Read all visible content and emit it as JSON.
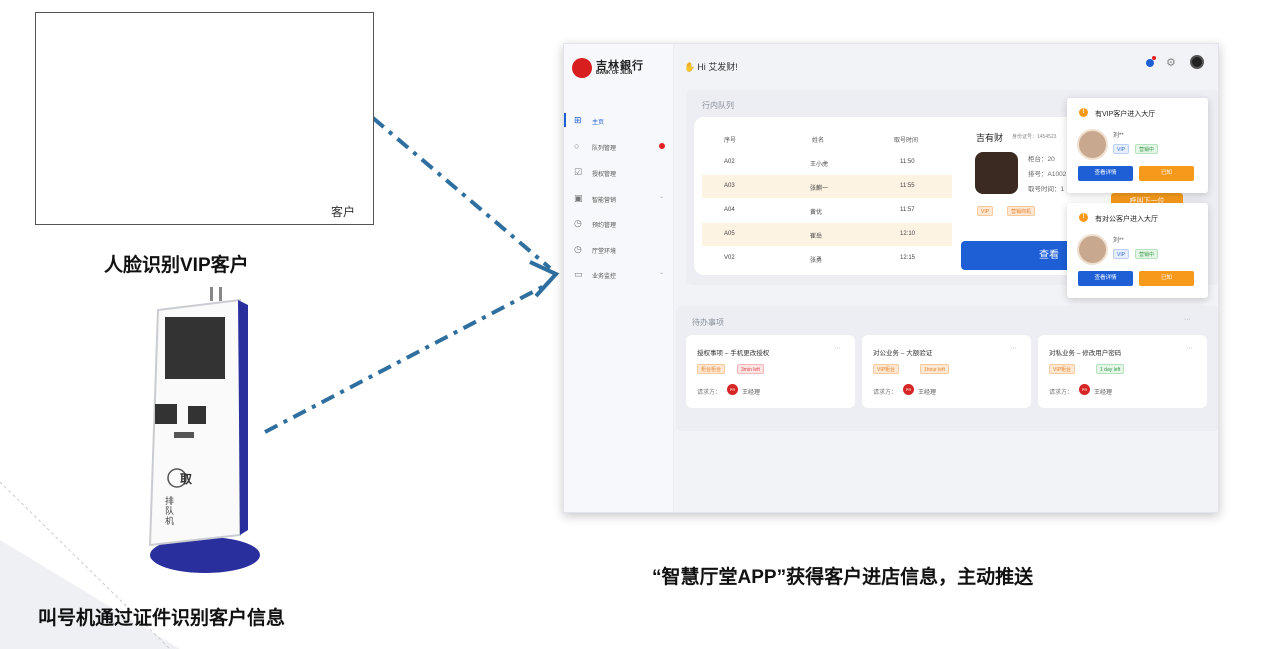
{
  "left_diagram": {
    "camera_customer_label": "客户",
    "caption_face": "人脸识别VIP客户",
    "caption_kiosk": "叫号机通过证件识别客户信息",
    "kiosk_text": "取",
    "kiosk_text2": "排队机"
  },
  "caption_app": "“智慧厅堂APP”获得客户进店信息，主动推送",
  "app": {
    "logo_cn": "吉林銀行",
    "logo_en": "BANK OF JILIN",
    "greeting": "Hi 艾发财!",
    "nav": [
      {
        "label": "主页",
        "icon": "grid-icon",
        "active": true
      },
      {
        "label": "队列管理",
        "icon": "chat-icon",
        "badge": true
      },
      {
        "label": "授权管理",
        "icon": "check-square-icon"
      },
      {
        "label": "智能营销",
        "icon": "calendar-icon",
        "chevron": true
      },
      {
        "label": "预约管理",
        "icon": "clock-icon"
      },
      {
        "label": "厅堂环境",
        "icon": "clock-icon"
      },
      {
        "label": "业务监控",
        "icon": "monitor-icon",
        "chevron": true
      }
    ],
    "queue": {
      "title": "行内队列",
      "headers": [
        "序号",
        "姓名",
        "取号时间"
      ],
      "rows": [
        [
          "A02",
          "王小虎",
          "11:50"
        ],
        [
          "A03",
          "张麒一",
          "11:55"
        ],
        [
          "A04",
          "黄优",
          "11:57"
        ],
        [
          "A05",
          "崔岳",
          "12:10"
        ],
        [
          "V02",
          "张勇",
          "12:15"
        ]
      ],
      "detail": {
        "name": "吉有财",
        "id_label": "身份证号：1454523",
        "counter": "柜台：20",
        "number": "排号：A1002",
        "time": "取号时间：1",
        "tag_vip": "VIP",
        "tag_business": "营销商机"
      },
      "next_button": "呼叫下一位",
      "view_button": "查看"
    },
    "todo": {
      "title": "待办事项",
      "more": "···",
      "cards": [
        {
          "title": "授权事项 – 手机更改授权",
          "tag1": "柜台柜台",
          "tag2": "3min left",
          "tag2_color": "red",
          "requester_label": "请求方：",
          "avatar": "PR",
          "name": "王经理"
        },
        {
          "title": "对公业务 – 大额验证",
          "tag1": "VIP柜台",
          "tag2": "1hour left",
          "tag2_color": "orange",
          "requester_label": "请求方：",
          "avatar": "PR",
          "name": "王经理"
        },
        {
          "title": "对私业务 – 修改用户密码",
          "tag1": "VIP柜台",
          "tag2": "1 day left",
          "tag2_color": "green",
          "requester_label": "请求方：",
          "avatar": "PR",
          "name": "王经理"
        }
      ]
    },
    "notifications": [
      {
        "title": "有VIP客户进入大厅",
        "name": "刘**",
        "tag1": "VIP",
        "tag2": "营销中",
        "primary": "查看详情",
        "secondary": "已知"
      },
      {
        "title": "有对公客户进入大厅",
        "name": "刘**",
        "tag1": "VIP",
        "tag2": "营销中",
        "primary": "查看详情",
        "secondary": "已知"
      }
    ]
  },
  "colors": {
    "arrow": "#2f6f9f",
    "brand": "#1e5fd6",
    "accent": "#f79a1c",
    "bank_red": "#d81e1e"
  }
}
